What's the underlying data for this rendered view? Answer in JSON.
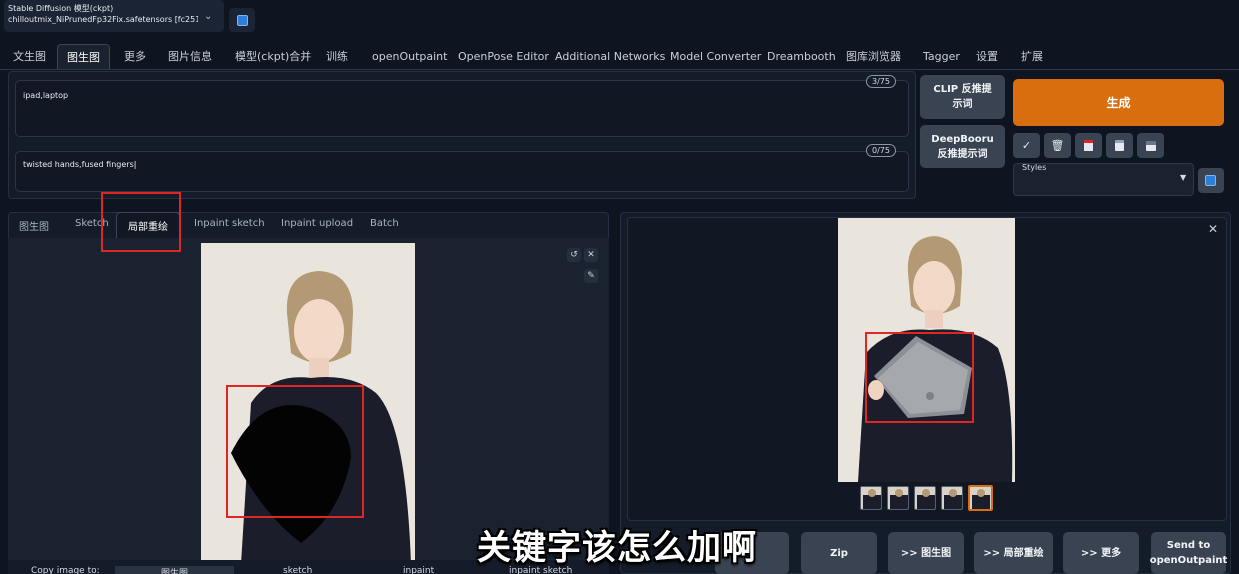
{
  "model": {
    "title": "Stable Diffusion 模型(ckpt)",
    "value": "chilloutmix_NiPrunedFp32Fix.safetensors [fc251"
  },
  "tabs": [
    "文生图",
    "图生图",
    "更多",
    "图片信息",
    "模型(ckpt)合并",
    "训练",
    "openOutpaint",
    "OpenPose Editor",
    "Additional Networks",
    "Model Converter",
    "Dreambooth",
    "图库浏览器",
    "Tagger",
    "设置",
    "扩展"
  ],
  "active_tab": "图生图",
  "prompt": {
    "positive": "ipad,laptop",
    "positive_count": "3/75",
    "negative": "twisted hands,fused fingers",
    "negative_count": "0/75"
  },
  "buttons": {
    "clip": "CLIP 反推提示词",
    "deepbooru": "DeepBooru 反推提示词",
    "generate": "生成",
    "styles_label": "Styles"
  },
  "tool_icons": [
    "check-icon",
    "trash-icon",
    "bookmark-icon",
    "clipboard-icon",
    "save-icon"
  ],
  "subtabs": [
    "图生图",
    "Sketch",
    "局部重绘",
    "Inpaint sketch",
    "Inpaint upload",
    "Batch"
  ],
  "active_subtab": "局部重绘",
  "copy_bar": {
    "label": "Copy image to:",
    "targets": [
      "图生图",
      "sketch",
      "inpaint",
      "inpaint sketch"
    ]
  },
  "send_buttons": [
    "Zip",
    ">> 图生图",
    ">> 局部重绘",
    ">> 更多",
    "Send to openOutpaint"
  ],
  "subtitle": "关键字该怎么加啊",
  "colors": {
    "accent": "#d86e0e",
    "highlight": "#e02525",
    "background": "#0e1420"
  }
}
